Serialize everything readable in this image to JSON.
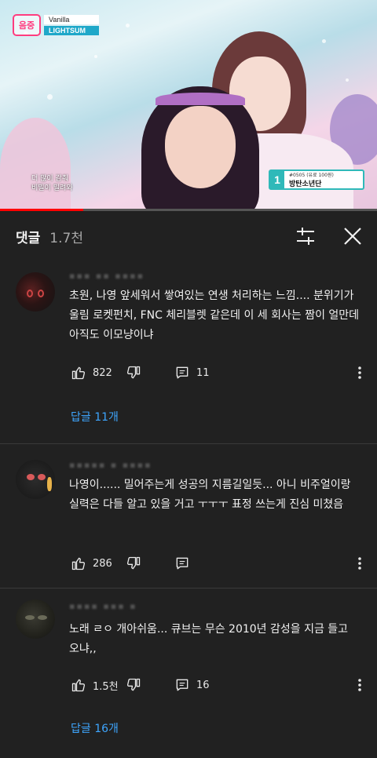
{
  "video": {
    "song_title": "Vanilla",
    "artist": "LIGHTSUM",
    "logo_text": "음중",
    "caption_line1": "더 많이 감춰",
    "caption_line2": "비밀이 밀려와",
    "chart_rank": "1",
    "chart_code": "#0505 (유료 100원)",
    "chart_name": "방탄소년단",
    "progress_fraction": 0.22
  },
  "header": {
    "title": "댓글",
    "count": "1.7천",
    "filter_icon": "filter-sliders-icon",
    "close_icon": "close-icon"
  },
  "comments": [
    {
      "text": "초원, 나영 앞세워서 쌓여있는 연생 처리하는 느낌.... 분위기가 울림 로켓펀치, FNC 체리블렛 같은데 이 세 회사는 짬이 얼만데 아직도 이모냥이냐",
      "likes": "822",
      "replies_count": "11",
      "replies_label": "답글 11개"
    },
    {
      "text": "나영이...... 밀어주는게 성공의 지름길일듯... 아니 비주얼이랑 실력은 다들 알고 있을 거고 ㅜㅜㅜ 표정 쓰는게 진심 미쳤음",
      "likes": "286",
      "replies_count": "",
      "replies_label": ""
    },
    {
      "text": "노래 ㄹㅇ 개아쉬움... 큐브는 무슨 2010년 감성을 지금 들고 오냐,,",
      "likes": "1.5천",
      "replies_count": "16",
      "replies_label": "답글 16개"
    }
  ],
  "colors": {
    "background": "#212121",
    "link": "#3ea6ff",
    "progress": "#ff0000"
  }
}
